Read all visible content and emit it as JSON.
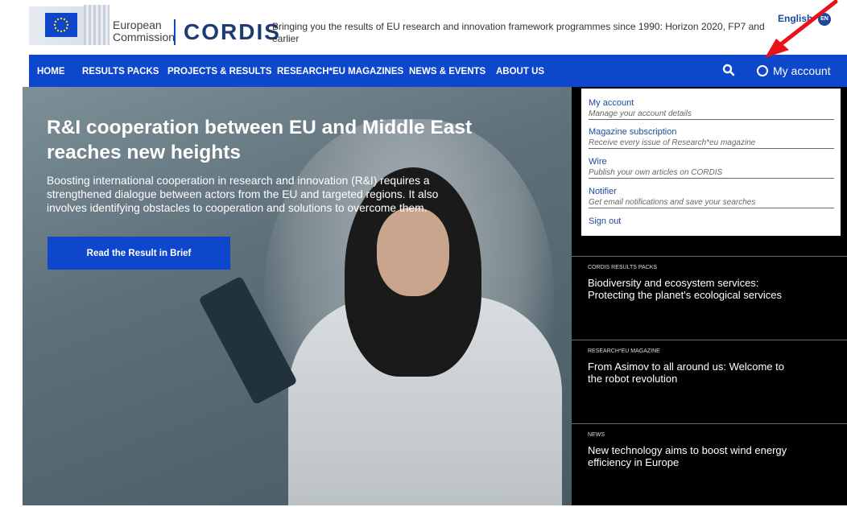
{
  "header": {
    "ec_line1": "European",
    "ec_line2": "Commission",
    "brand": "CORDIS",
    "tagline": "Bringing you the results of EU research and innovation framework programmes since 1990: Horizon 2020, FP7 and earlier",
    "language": "English",
    "language_badge": "EN"
  },
  "nav": {
    "items": [
      "HOME",
      "RESULTS PACKS",
      "PROJECTS & RESULTS",
      "RESEARCH*EU MAGAZINES",
      "NEWS & EVENTS",
      "ABOUT US"
    ],
    "search_icon": "search-icon",
    "account_label": "My account"
  },
  "hero": {
    "title": "R&I cooperation between EU and Middle East reaches new heights",
    "text": "Boosting international cooperation in research and innovation (R&I) requires a strengthened dialogue between actors from the EU and targeted regions. It also involves identifying obstacles to cooperation and solutions to overcome them.",
    "button": "Read the Result in Brief"
  },
  "dropdown": {
    "items": [
      {
        "label": "My account",
        "desc": "Manage your account details"
      },
      {
        "label": "Magazine subscription",
        "desc": "Receive every issue of Research*eu magazine"
      },
      {
        "label": "Wire",
        "desc": "Publish your own articles on CORDIS"
      },
      {
        "label": "Notifier",
        "desc": "Get email notifications and save your searches"
      }
    ],
    "signout": "Sign out"
  },
  "side": {
    "cards": [
      {
        "category": "CORDIS RESULTS PACKS",
        "title": "Biodiversity and ecosystem services: Protecting the planet's ecological services"
      },
      {
        "category": "RESEARCH*EU MAGAZINE",
        "title": "From Asimov to all around us: Welcome to the robot revolution"
      },
      {
        "category": "NEWS",
        "title": "New technology aims to boost wind energy efficiency in Europe"
      }
    ]
  },
  "colors": {
    "nav_blue": "#0e47cb",
    "annotation_red": "#e8121b"
  }
}
